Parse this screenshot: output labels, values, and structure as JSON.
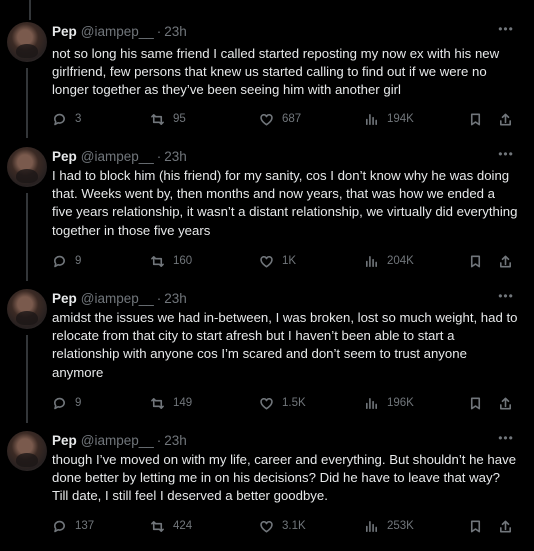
{
  "tweets": [
    {
      "name": "Pep",
      "handle": "@iampep__",
      "separator": "·",
      "time": "23h",
      "text": "not so long his same friend I called started reposting my now ex with his new girlfriend, few persons that knew us started calling to find out if we were no longer together as they’ve been seeing him with another girl",
      "replies": "3",
      "reposts": "95",
      "likes": "687",
      "views": "194K"
    },
    {
      "name": "Pep",
      "handle": "@iampep__",
      "separator": "·",
      "time": "23h",
      "text": "I had to block him (his friend) for my sanity, cos I don’t know why he was doing that. Weeks went by, then months and now years, that was how we ended a five years relationship, it wasn’t a distant relationship, we virtually did everything together in those five years",
      "replies": "9",
      "reposts": "160",
      "likes": "1K",
      "views": "204K"
    },
    {
      "name": "Pep",
      "handle": "@iampep__",
      "separator": "·",
      "time": "23h",
      "text": "amidst the issues we had in-between, I was broken, lost so much weight, had to relocate from that city to start afresh but I haven’t been able to start a relationship with anyone cos I’m scared and don’t seem to trust anyone anymore",
      "replies": "9",
      "reposts": "149",
      "likes": "1.5K",
      "views": "196K"
    },
    {
      "name": "Pep",
      "handle": "@iampep__",
      "separator": "·",
      "time": "23h",
      "text": "though I’ve moved on with my life, career and everything. But shouldn’t he have done better by letting me in on his decisions? Did he have to leave that way? Till date, I still feel I deserved a better goodbye.",
      "replies": "137",
      "reposts": "424",
      "likes": "3.1K",
      "views": "253K"
    }
  ],
  "icons": {
    "more": "more-icon",
    "reply": "reply-icon",
    "repost": "repost-icon",
    "like": "like-icon",
    "views": "views-icon",
    "bookmark": "bookmark-icon",
    "share": "share-icon"
  },
  "colors": {
    "background": "#000000",
    "text": "#e7e9ea",
    "secondary_text": "#71767b",
    "thread_line": "#333639"
  }
}
